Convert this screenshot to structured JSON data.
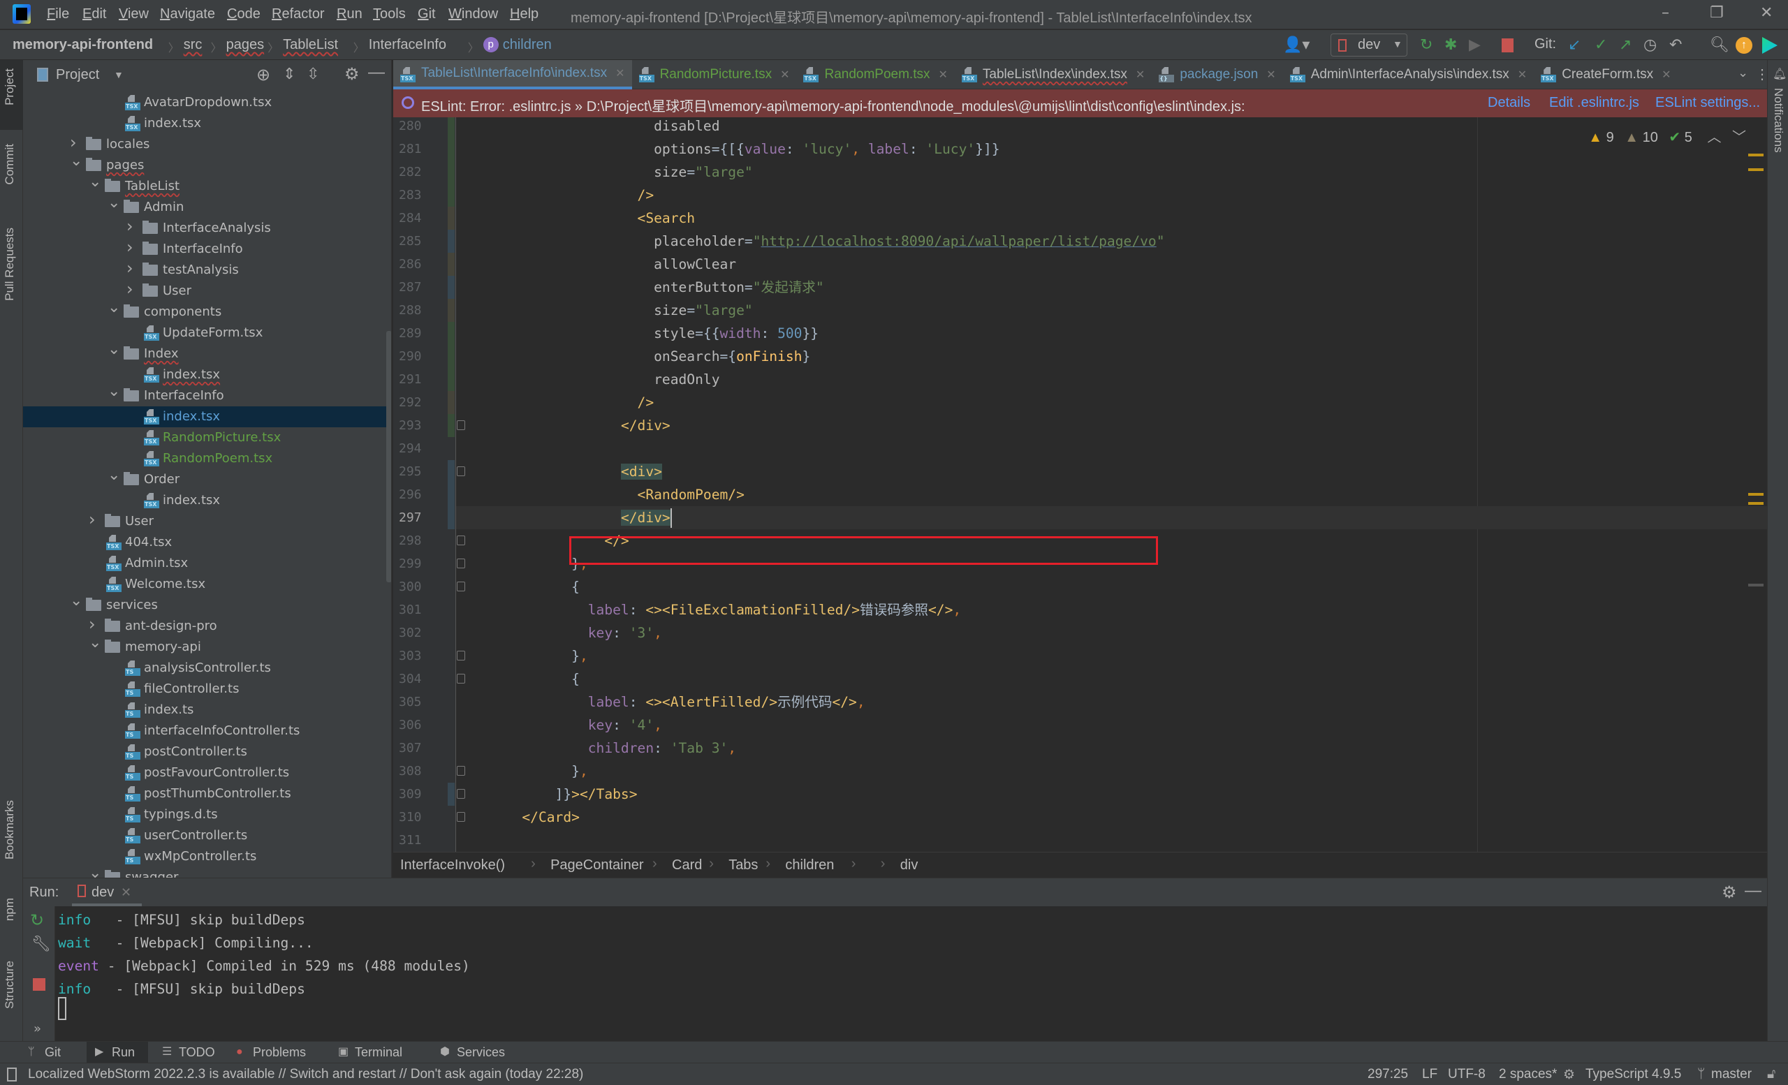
{
  "titlebar": {
    "menus": [
      "File",
      "Edit",
      "View",
      "Navigate",
      "Code",
      "Refactor",
      "Run",
      "Tools",
      "Git",
      "Window",
      "Help"
    ],
    "title": "memory-api-frontend [D:\\Project\\星球项目\\memory-api\\memory-api-frontend] - TableList\\InterfaceInfo\\index.tsx",
    "controls": {
      "minimize": "–",
      "restore": "❐",
      "close": "✕"
    }
  },
  "navbar": {
    "breadcrumbs": [
      {
        "label": "memory-api-frontend",
        "bold": true
      },
      {
        "label": "src",
        "err": true
      },
      {
        "label": "pages",
        "err": true
      },
      {
        "label": "TableList",
        "err": true
      },
      {
        "label": "InterfaceInfo"
      },
      {
        "label": "children",
        "badge": "p"
      }
    ],
    "run_config": "dev",
    "git_label": "Git:"
  },
  "left_stripe": [
    "Project",
    "Commit",
    "Pull Requests",
    "Bookmarks",
    "npm",
    "Structure"
  ],
  "right_stripe": [
    "Notifications"
  ],
  "project": {
    "title": "Project",
    "tree": [
      {
        "label": "AvatarDropdown.tsx",
        "level": 2,
        "kind": "tsx"
      },
      {
        "label": "index.tsx",
        "level": 2,
        "kind": "tsx"
      },
      {
        "label": "locales",
        "level": 0,
        "kind": "folder",
        "open": false
      },
      {
        "label": "pages",
        "level": 0,
        "kind": "folder",
        "open": true,
        "err": true
      },
      {
        "label": "TableList",
        "level": 1,
        "kind": "folder",
        "open": true,
        "err": true
      },
      {
        "label": "Admin",
        "level": 2,
        "kind": "folder",
        "open": true
      },
      {
        "label": "InterfaceAnalysis",
        "level": 3,
        "kind": "folder",
        "open": false
      },
      {
        "label": "InterfaceInfo",
        "level": 3,
        "kind": "folder",
        "open": false
      },
      {
        "label": "testAnalysis",
        "level": 3,
        "kind": "folder",
        "open": false
      },
      {
        "label": "User",
        "level": 3,
        "kind": "folder",
        "open": false
      },
      {
        "label": "components",
        "level": 2,
        "kind": "folder",
        "open": true
      },
      {
        "label": "UpdateForm.tsx",
        "level": 3,
        "kind": "tsx"
      },
      {
        "label": "Index",
        "level": 2,
        "kind": "folder",
        "open": true,
        "err": true
      },
      {
        "label": "index.tsx",
        "level": 3,
        "kind": "tsx",
        "err": true
      },
      {
        "label": "InterfaceInfo",
        "level": 2,
        "kind": "folder",
        "open": true
      },
      {
        "label": "index.tsx",
        "level": 3,
        "kind": "tsx",
        "selected": true
      },
      {
        "label": "RandomPicture.tsx",
        "level": 3,
        "kind": "tsx",
        "status": "new"
      },
      {
        "label": "RandomPoem.tsx",
        "level": 3,
        "kind": "tsx",
        "status": "new"
      },
      {
        "label": "Order",
        "level": 2,
        "kind": "folder",
        "open": true
      },
      {
        "label": "index.tsx",
        "level": 3,
        "kind": "tsx"
      },
      {
        "label": "User",
        "level": 1,
        "kind": "folder",
        "open": false
      },
      {
        "label": "404.tsx",
        "level": 1,
        "kind": "tsx"
      },
      {
        "label": "Admin.tsx",
        "level": 1,
        "kind": "tsx"
      },
      {
        "label": "Welcome.tsx",
        "level": 1,
        "kind": "tsx"
      },
      {
        "label": "services",
        "level": 0,
        "kind": "folder",
        "open": true
      },
      {
        "label": "ant-design-pro",
        "level": 1,
        "kind": "folder",
        "open": false
      },
      {
        "label": "memory-api",
        "level": 1,
        "kind": "folder",
        "open": true
      },
      {
        "label": "analysisController.ts",
        "level": 2,
        "kind": "ts"
      },
      {
        "label": "fileController.ts",
        "level": 2,
        "kind": "ts"
      },
      {
        "label": "index.ts",
        "level": 2,
        "kind": "ts"
      },
      {
        "label": "interfaceInfoController.ts",
        "level": 2,
        "kind": "ts"
      },
      {
        "label": "postController.ts",
        "level": 2,
        "kind": "ts"
      },
      {
        "label": "postFavourController.ts",
        "level": 2,
        "kind": "ts"
      },
      {
        "label": "postThumbController.ts",
        "level": 2,
        "kind": "ts"
      },
      {
        "label": "typings.d.ts",
        "level": 2,
        "kind": "ts"
      },
      {
        "label": "userController.ts",
        "level": 2,
        "kind": "ts"
      },
      {
        "label": "wxMpController.ts",
        "level": 2,
        "kind": "ts"
      },
      {
        "label": "swagger",
        "level": 1,
        "kind": "folder",
        "open": true
      }
    ]
  },
  "tabs": [
    {
      "label": "TableList\\InterfaceInfo\\index.tsx",
      "kind": "tsx",
      "active": true,
      "color": "#6897bb"
    },
    {
      "label": "RandomPicture.tsx",
      "kind": "tsx",
      "color": "#62a044"
    },
    {
      "label": "RandomPoem.tsx",
      "kind": "tsx",
      "color": "#62a044"
    },
    {
      "label": "TableList\\Index\\index.tsx",
      "kind": "tsx",
      "color": "#bbbbbb",
      "err": true
    },
    {
      "label": "package.json",
      "kind": "json",
      "color": "#6897bb"
    },
    {
      "label": "Admin\\InterfaceAnalysis\\index.tsx",
      "kind": "tsx",
      "color": "#bbbbbb"
    },
    {
      "label": "CreateForm.tsx",
      "kind": "tsx",
      "color": "#bbbbbb"
    }
  ],
  "banner": {
    "message": "ESLint: Error: .eslintrc.js » D:\\Project\\星球项目\\memory-api\\memory-api-frontend\\node_modules\\@umijs\\lint\\dist\\config\\eslint\\index.js:",
    "links": [
      "Details",
      "Edit .eslintrc.js",
      "ESLint settings..."
    ]
  },
  "inspections": {
    "errors": "9",
    "warnings": "10",
    "typos": "5"
  },
  "code": {
    "current_line": 297,
    "lines": [
      {
        "n": 280,
        "i": "                        ",
        "vcs": "added",
        "t": [
          [
            "attr",
            "disabled"
          ]
        ]
      },
      {
        "n": 281,
        "i": "                        ",
        "vcs": "added",
        "t": [
          [
            "attr",
            "options"
          ],
          [
            "punc",
            "={[{"
          ],
          [
            "key",
            "value"
          ],
          [
            "punc",
            ": "
          ],
          [
            "str",
            "'lucy'"
          ],
          [
            "comma",
            ", "
          ],
          [
            "key",
            "label"
          ],
          [
            "punc",
            ": "
          ],
          [
            "str",
            "'Lucy'"
          ],
          [
            "punc",
            "}]}"
          ]
        ]
      },
      {
        "n": 282,
        "i": "                        ",
        "vcs": "added",
        "t": [
          [
            "attr",
            "size"
          ],
          [
            "punc",
            "="
          ],
          [
            "str",
            "\"large\""
          ]
        ]
      },
      {
        "n": 283,
        "i": "                      ",
        "vcs": "added",
        "t": [
          [
            "tag",
            "/>"
          ]
        ]
      },
      {
        "n": 284,
        "i": "                      ",
        "vcs": "modified",
        "t": [
          [
            "tag",
            "<Search"
          ]
        ]
      },
      {
        "n": 285,
        "i": "                        ",
        "vcs": "changed",
        "t": [
          [
            "attr",
            "placeholder"
          ],
          [
            "punc",
            "="
          ],
          [
            "str",
            "\""
          ],
          [
            "url",
            "http://localhost:8090/api/wallpaper/list/page/vo"
          ],
          [
            "str",
            "\""
          ]
        ]
      },
      {
        "n": 286,
        "i": "                        ",
        "vcs": "modified",
        "t": [
          [
            "attr",
            "allowClear"
          ]
        ]
      },
      {
        "n": 287,
        "i": "                        ",
        "vcs": "changed",
        "t": [
          [
            "attr",
            "enterButton"
          ],
          [
            "punc",
            "="
          ],
          [
            "str",
            "\"发起请求\""
          ]
        ]
      },
      {
        "n": 288,
        "i": "                        ",
        "vcs": "modified",
        "t": [
          [
            "attr",
            "size"
          ],
          [
            "punc",
            "="
          ],
          [
            "str",
            "\"large\""
          ]
        ]
      },
      {
        "n": 289,
        "i": "                        ",
        "vcs": "added",
        "t": [
          [
            "attr",
            "style"
          ],
          [
            "punc",
            "={{"
          ],
          [
            "key",
            "width"
          ],
          [
            "punc",
            ": "
          ],
          [
            "num",
            "500"
          ],
          [
            "punc",
            "}}"
          ]
        ]
      },
      {
        "n": 290,
        "i": "                        ",
        "vcs": "added",
        "t": [
          [
            "attr",
            "onSearch"
          ],
          [
            "punc",
            "={"
          ],
          [
            "fn",
            "onFinish"
          ],
          [
            "punc",
            "}"
          ]
        ]
      },
      {
        "n": 291,
        "i": "                        ",
        "vcs": "added",
        "t": [
          [
            "attr",
            "readOnly"
          ]
        ]
      },
      {
        "n": 292,
        "i": "                      ",
        "vcs": "modified",
        "t": [
          [
            "tag",
            "/>"
          ]
        ]
      },
      {
        "n": 293,
        "i": "                    ",
        "vcs": "added",
        "fold": true,
        "t": [
          [
            "tag",
            "</div>"
          ]
        ]
      },
      {
        "n": 294,
        "i": "",
        "t": []
      },
      {
        "n": 295,
        "i": "                    ",
        "vcs": "changed",
        "fold": true,
        "t": [
          [
            "taghl",
            "<div>"
          ]
        ]
      },
      {
        "n": 296,
        "i": "                      ",
        "vcs": "changed",
        "t": [
          [
            "tag",
            "<RandomPoem/>"
          ]
        ]
      },
      {
        "n": 297,
        "i": "                    ",
        "vcs": "changed",
        "fold": true,
        "t": [
          [
            "taghl",
            "</div>"
          ]
        ]
      },
      {
        "n": 298,
        "i": "                  ",
        "fold": true,
        "t": [
          [
            "tag",
            "</>"
          ]
        ]
      },
      {
        "n": 299,
        "i": "              ",
        "fold": true,
        "t": [
          [
            "punc",
            "}"
          ],
          [
            "comma",
            ","
          ]
        ]
      },
      {
        "n": 300,
        "i": "              ",
        "fold": true,
        "t": [
          [
            "punc",
            "{"
          ]
        ]
      },
      {
        "n": 301,
        "i": "                ",
        "t": [
          [
            "key",
            "label"
          ],
          [
            "punc",
            ": "
          ],
          [
            "tag",
            "<><FileExclamationFilled/>"
          ],
          [
            "text",
            "错误码参照"
          ],
          [
            "tag",
            "</>"
          ],
          [
            "comma",
            ","
          ]
        ]
      },
      {
        "n": 302,
        "i": "                ",
        "t": [
          [
            "key",
            "key"
          ],
          [
            "punc",
            ": "
          ],
          [
            "str",
            "'3'"
          ],
          [
            "comma",
            ","
          ]
        ]
      },
      {
        "n": 303,
        "i": "              ",
        "fold": true,
        "t": [
          [
            "punc",
            "}"
          ],
          [
            "comma",
            ","
          ]
        ]
      },
      {
        "n": 304,
        "i": "              ",
        "fold": true,
        "t": [
          [
            "punc",
            "{"
          ]
        ]
      },
      {
        "n": 305,
        "i": "                ",
        "t": [
          [
            "key",
            "label"
          ],
          [
            "punc",
            ": "
          ],
          [
            "tag",
            "<><AlertFilled/>"
          ],
          [
            "text",
            "示例代码"
          ],
          [
            "tag",
            "</>"
          ],
          [
            "comma",
            ","
          ]
        ]
      },
      {
        "n": 306,
        "i": "                ",
        "t": [
          [
            "key",
            "key"
          ],
          [
            "punc",
            ": "
          ],
          [
            "str",
            "'4'"
          ],
          [
            "comma",
            ","
          ]
        ]
      },
      {
        "n": 307,
        "i": "                ",
        "t": [
          [
            "key",
            "children"
          ],
          [
            "punc",
            ": "
          ],
          [
            "str",
            "'Tab 3'"
          ],
          [
            "comma",
            ","
          ]
        ]
      },
      {
        "n": 308,
        "i": "              ",
        "fold": true,
        "t": [
          [
            "punc",
            "}"
          ],
          [
            "comma",
            ","
          ]
        ]
      },
      {
        "n": 309,
        "i": "            ",
        "vcs": "changed",
        "fold": true,
        "t": [
          [
            "punc",
            "]}"
          ],
          [
            "tag",
            "></Tabs>"
          ]
        ]
      },
      {
        "n": 310,
        "i": "        ",
        "fold": true,
        "t": [
          [
            "tag",
            "</Card>"
          ]
        ]
      },
      {
        "n": 311,
        "i": "",
        "t": []
      }
    ]
  },
  "editor_breadcrumbs": [
    "InterfaceInvoke()",
    "PageContainer",
    "Card",
    "Tabs",
    "children",
    "",
    "div"
  ],
  "run": {
    "label": "Run:",
    "tab": "dev",
    "console": [
      {
        "level": "info",
        "pad": "  ",
        "msg": " - [MFSU] skip buildDeps",
        "color": "#2fb8b8"
      },
      {
        "level": "wait",
        "pad": "  ",
        "msg": " - [Webpack] Compiling...",
        "color": "#2fb8b8"
      },
      {
        "level": "event",
        "pad": "",
        "msg": " - [Webpack] Compiled in 529 ms (488 modules)",
        "color": "#a76fd0"
      },
      {
        "level": "info",
        "pad": "  ",
        "msg": " - [MFSU] skip buildDeps",
        "color": "#2fb8b8"
      }
    ]
  },
  "tool_tabs": [
    {
      "label": "Git",
      "icon": "git-branch-icon"
    },
    {
      "label": "Run",
      "icon": "run-icon",
      "active": true
    },
    {
      "label": "TODO",
      "icon": "list-icon"
    },
    {
      "label": "Problems",
      "icon": "problems-icon"
    },
    {
      "label": "Terminal",
      "icon": "terminal-icon"
    },
    {
      "label": "Services",
      "icon": "services-icon"
    }
  ],
  "status": {
    "message": "Localized WebStorm 2022.2.3 is available // Switch and restart // Don't ask again (today 22:28)",
    "position": "297:25",
    "line_sep": "LF",
    "encoding": "UTF-8",
    "indent": "2 spaces*",
    "language": "TypeScript 4.9.5",
    "branch": "master"
  },
  "colors": {
    "banner": "#743a3a",
    "accent": "#4a88c7",
    "highlight_box": "#e5202a",
    "selection": "#0d293e"
  }
}
